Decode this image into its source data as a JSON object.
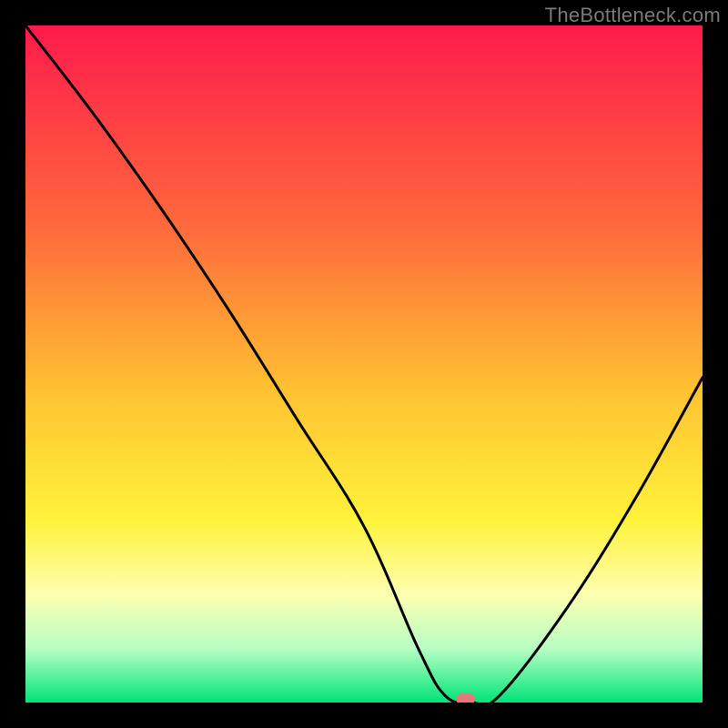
{
  "watermark": "TheBottleneck.com",
  "chart_data": {
    "type": "line",
    "title": "",
    "xlabel": "",
    "ylabel": "",
    "xlim": [
      0,
      100
    ],
    "ylim": [
      0,
      100
    ],
    "grid": false,
    "legend": false,
    "series": [
      {
        "name": "curve",
        "x": [
          0,
          10,
          20,
          30,
          40,
          50,
          58,
          62,
          66,
          70,
          80,
          90,
          100
        ],
        "y": [
          100,
          87,
          73,
          58,
          42,
          26,
          8,
          1,
          0,
          1,
          14,
          30,
          48
        ]
      }
    ],
    "marker": {
      "x": 65,
      "y": 0.5
    },
    "gradient_stops": [
      {
        "pct": 0,
        "color": "#ff1a4c"
      },
      {
        "pct": 30,
        "color": "#ff6a3c"
      },
      {
        "pct": 55,
        "color": "#ffc531"
      },
      {
        "pct": 73,
        "color": "#fff23a"
      },
      {
        "pct": 84,
        "color": "#fdffb0"
      },
      {
        "pct": 92,
        "color": "#b8ffc4"
      },
      {
        "pct": 100,
        "color": "#00e477"
      }
    ]
  }
}
